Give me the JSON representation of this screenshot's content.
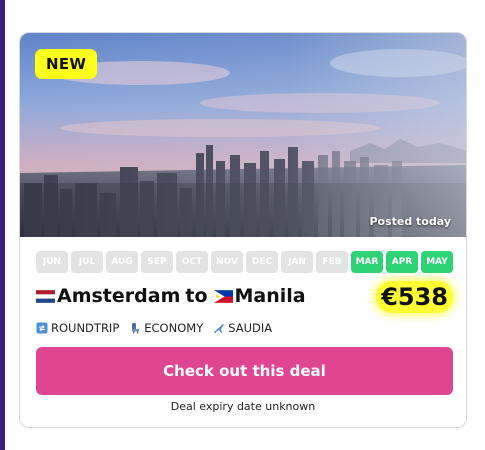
{
  "deal": {
    "badge": "NEW",
    "posted": "Posted today",
    "months": [
      {
        "label": "JUN",
        "active": false
      },
      {
        "label": "JUL",
        "active": false
      },
      {
        "label": "AUG",
        "active": false
      },
      {
        "label": "SEP",
        "active": false
      },
      {
        "label": "OCT",
        "active": false
      },
      {
        "label": "NOV",
        "active": false
      },
      {
        "label": "DEC",
        "active": false
      },
      {
        "label": "JAN",
        "active": false
      },
      {
        "label": "FEB",
        "active": false
      },
      {
        "label": "MAR",
        "active": true
      },
      {
        "label": "APR",
        "active": true
      },
      {
        "label": "MAY",
        "active": true
      }
    ],
    "origin": "Amsterdam",
    "connector": "to",
    "destination": "Manila",
    "price": "€538",
    "trip_type": "ROUNDTRIP",
    "cabin": "ECONOMY",
    "airline": "SAUDIA",
    "cta_label": "Check out this deal",
    "expiry": "Deal expiry date unknown"
  },
  "icons": {
    "origin_flag": "netherlands-flag-icon",
    "destination_flag": "philippines-flag-icon",
    "trip": "roundtrip-icon",
    "cabin": "seat-icon",
    "airline": "airplane-icon"
  },
  "colors": {
    "accent": "#e04592",
    "new_badge": "#ffff1a",
    "active_month": "#2ed376",
    "inactive_month": "#e3e3e3",
    "price_highlight": "#ffff33"
  }
}
